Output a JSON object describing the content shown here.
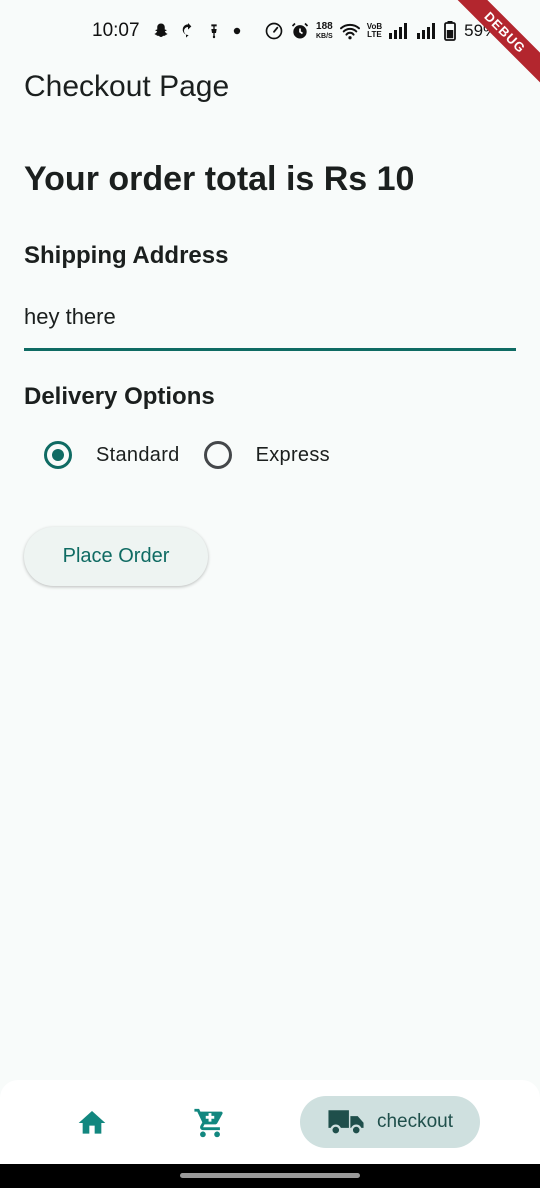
{
  "status_bar": {
    "time": "10:07",
    "net_speed_value": "188",
    "net_speed_unit": "KB/S",
    "volte_top": "VoB",
    "volte_bottom": "LTE",
    "battery": "59%"
  },
  "debug_banner": "DEBUG",
  "app_bar": {
    "title": "Checkout Page"
  },
  "order": {
    "total_text": "Your order total is Rs 10"
  },
  "shipping": {
    "label": "Shipping Address",
    "value": "hey there"
  },
  "delivery": {
    "label": "Delivery Options",
    "options": [
      {
        "label": "Standard",
        "selected": true
      },
      {
        "label": "Express",
        "selected": false
      }
    ]
  },
  "actions": {
    "place_order": "Place Order"
  },
  "bottom_nav": {
    "items": [
      {
        "icon": "home-icon",
        "label": ""
      },
      {
        "icon": "cart-icon",
        "label": ""
      },
      {
        "icon": "truck-icon",
        "label": "checkout",
        "active": true
      }
    ]
  },
  "colors": {
    "primary": "#0f6b63",
    "background": "#f8fbfa",
    "nav_active": "#cfe0df",
    "nav_icon": "#12877f",
    "debug": "#b3262e"
  }
}
